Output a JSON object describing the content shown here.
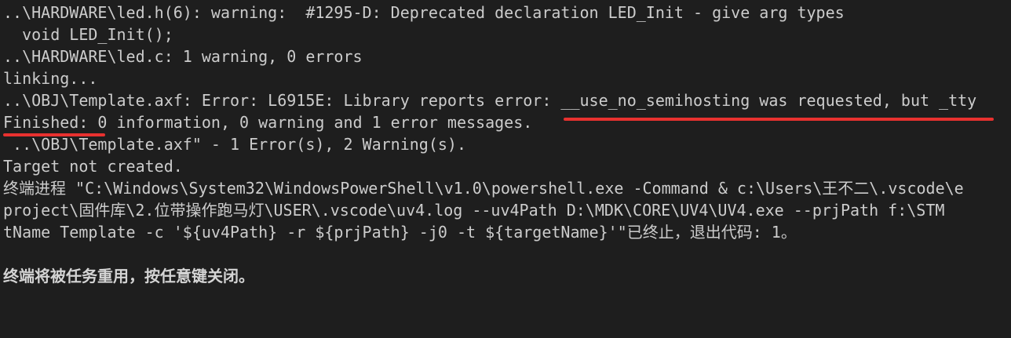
{
  "terminal": {
    "lines": [
      "..\\HARDWARE\\led.h(6): warning:  #1295-D: Deprecated declaration LED_Init - give arg types",
      "  void LED_Init();",
      "..\\HARDWARE\\led.c: 1 warning, 0 errors",
      "linking...",
      "..\\OBJ\\Template.axf: Error: L6915E: Library reports error: __use_no_semihosting was requested, but _tty",
      "Finished: 0 information, 0 warning and 1 error messages.",
      " ..\\OBJ\\Template.axf\" - 1 Error(s), 2 Warning(s).",
      "Target not created.",
      "终端进程 \"C:\\Windows\\System32\\WindowsPowerShell\\v1.0\\powershell.exe -Command & c:\\Users\\王不二\\.vscode\\e",
      "project\\固件库\\2.位带操作跑马灯\\USER\\.vscode\\uv4.log --uv4Path D:\\MDK\\CORE\\UV4\\UV4.exe --prjPath f:\\STM",
      "tName Template -c '${uv4Path} -r ${prjPath} -j0 -t ${targetName}'\"已终止，退出代码: 1。",
      "",
      "终端将被任务重用，按任意键关闭。"
    ]
  },
  "colors": {
    "background": "#1e1e1e",
    "text": "#cccccc",
    "annotation": "#e8312f"
  }
}
